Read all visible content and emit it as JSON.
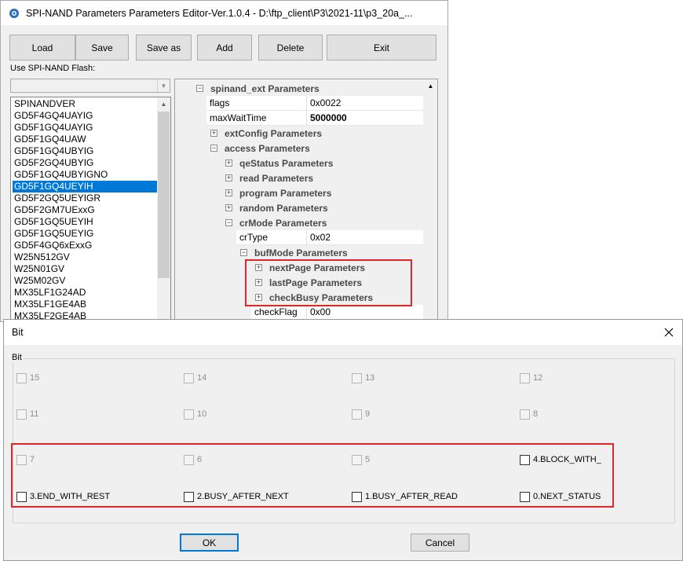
{
  "main_window": {
    "title": "SPI-NAND Parameters Parameters Editor-Ver.1.0.4 - D:\\ftp_client\\P3\\2021-11\\p3_20a_..."
  },
  "toolbar": {
    "load": "Load",
    "save": "Save",
    "save_as": "Save as",
    "add": "Add",
    "delete": "Delete",
    "exit": "Exit"
  },
  "flash": {
    "label": "Use SPI-NAND Flash:",
    "combo_value": "",
    "items": [
      "SPINANDVER",
      "GD5F4GQ4UAYIG",
      "GD5F1GQ4UAYIG",
      "GD5F1GQ4UAW",
      "GD5F1GQ4UBYIG",
      "GD5F2GQ4UBYIG",
      "GD5F1GQ4UBYIGNO",
      "GD5F1GQ4UEYIH",
      "GD5F2GQ5UEYIGR",
      "GD5F2GM7UExxG",
      "GD5F1GQ5UEYIH",
      "GD5F1GQ5UEYIG",
      "GD5F4GQ6xExxG",
      "W25N512GV",
      "W25N01GV",
      "W25M02GV",
      "MX35LF1G24AD",
      "MX35LF1GE4AB",
      "MX35LF2GE4AB"
    ],
    "selected_index": 7
  },
  "tree": {
    "root": "spinand_ext Parameters",
    "flags_name": "flags",
    "flags_value": "0x0022",
    "maxwait_name": "maxWaitTime",
    "maxwait_value": "5000000",
    "extconfig": "extConfig Parameters",
    "access": "access Parameters",
    "qestatus": "qeStatus Parameters",
    "read": "read Parameters",
    "program": "program Parameters",
    "random": "random Parameters",
    "crmode": "crMode Parameters",
    "crtype_name": "crType",
    "crtype_value": "0x02",
    "bufmode": "bufMode Parameters",
    "nextpage": "nextPage Parameters",
    "lastpage": "lastPage Parameters",
    "checkbusy": "checkBusy Parameters",
    "checkflag_name": "checkFlag",
    "checkflag_value": "0x00"
  },
  "bit_dialog": {
    "title": "Bit",
    "group_label": "Bit",
    "bits": [
      {
        "label": "15",
        "enabled": false,
        "checked": false
      },
      {
        "label": "14",
        "enabled": false,
        "checked": false
      },
      {
        "label": "13",
        "enabled": false,
        "checked": false
      },
      {
        "label": "12",
        "enabled": false,
        "checked": false
      },
      {
        "label": "11",
        "enabled": false,
        "checked": false
      },
      {
        "label": "10",
        "enabled": false,
        "checked": false
      },
      {
        "label": "9",
        "enabled": false,
        "checked": false
      },
      {
        "label": "8",
        "enabled": false,
        "checked": false
      },
      {
        "label": "7",
        "enabled": false,
        "checked": false
      },
      {
        "label": "6",
        "enabled": false,
        "checked": false
      },
      {
        "label": "5",
        "enabled": false,
        "checked": false
      },
      {
        "label": "4.BLOCK_WITH_",
        "enabled": true,
        "checked": false
      },
      {
        "label": "3.END_WITH_REST",
        "enabled": true,
        "checked": false
      },
      {
        "label": "2.BUSY_AFTER_NEXT",
        "enabled": true,
        "checked": false
      },
      {
        "label": "1.BUSY_AFTER_READ",
        "enabled": true,
        "checked": false
      },
      {
        "label": "0.NEXT_STATUS",
        "enabled": true,
        "checked": false
      }
    ],
    "ok": "OK",
    "cancel": "Cancel"
  },
  "colors": {
    "highlight": "#e0262d",
    "selection": "#0078d7"
  }
}
